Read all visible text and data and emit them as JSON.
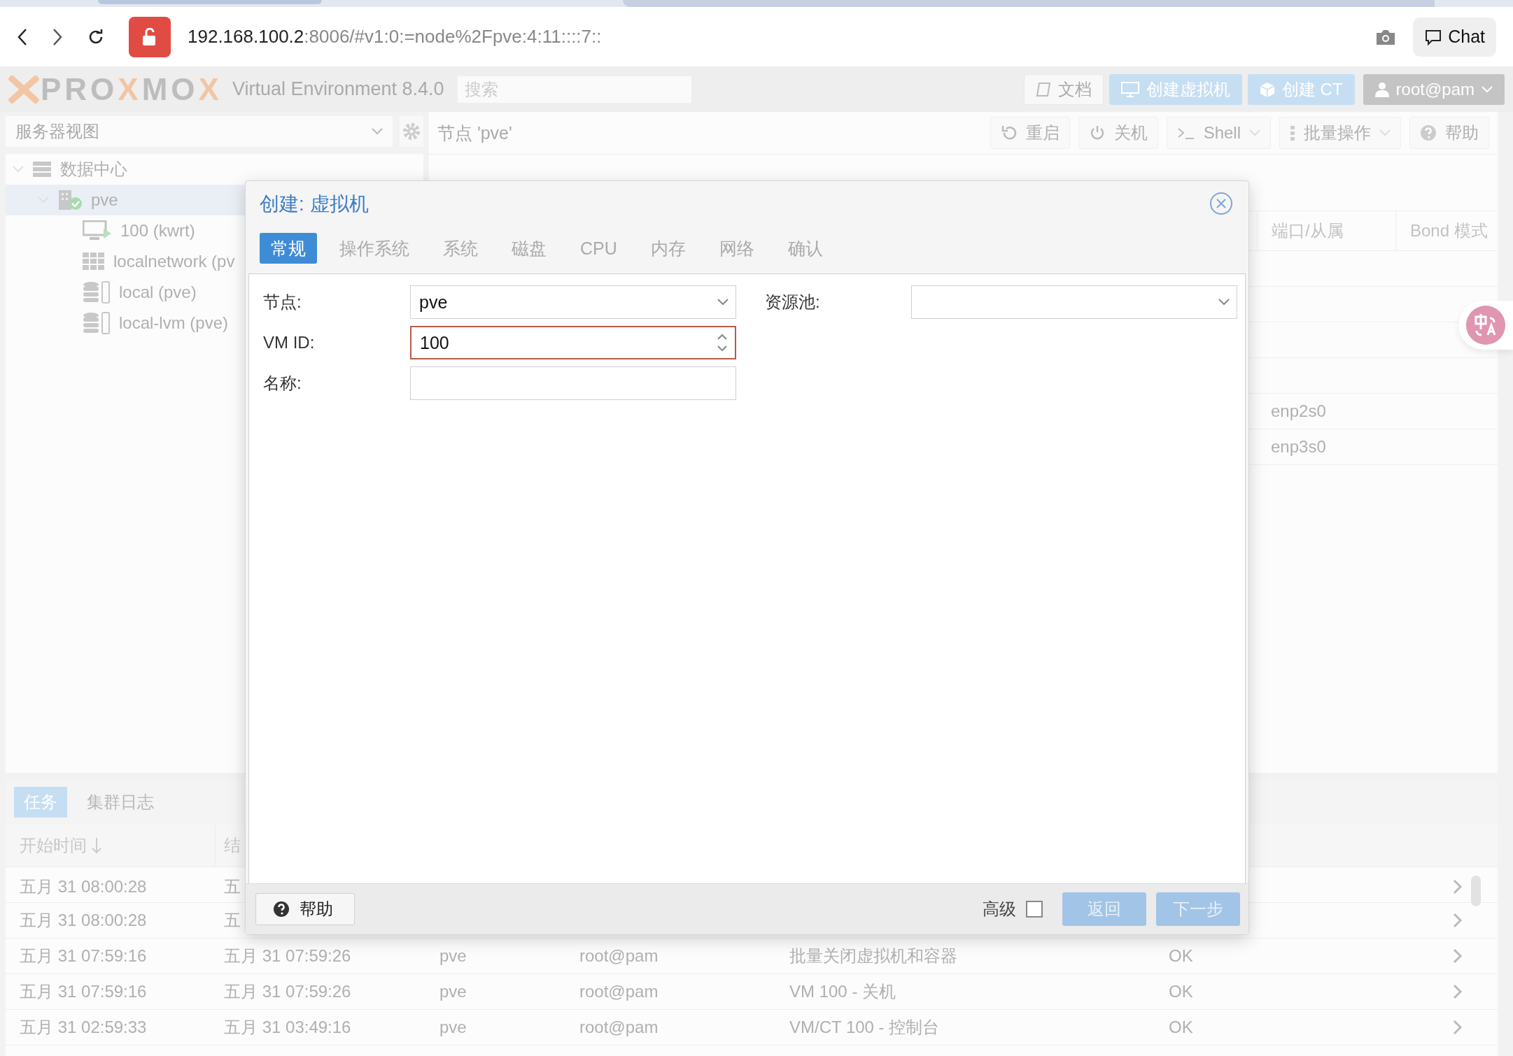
{
  "browser": {
    "url_host": "192.168.100.2",
    "url_rest": ":8006/#v1:0:=node%2Fpve:4:11::::7::",
    "chat_button": "Chat"
  },
  "header": {
    "logo": [
      "PRO",
      "X",
      "MO",
      "X"
    ],
    "product": "Virtual Environment 8.4.0",
    "search": {
      "placeholder": "搜索"
    },
    "buttons": [
      {
        "label": "文档",
        "kind": "docs"
      },
      {
        "label": "创建虚拟机",
        "kind": "vm"
      },
      {
        "label": "创建 CT",
        "kind": "ct"
      },
      {
        "label": "root@pam",
        "kind": "user"
      }
    ]
  },
  "sidebar": {
    "view_select": "服务器视图",
    "tree": [
      {
        "label": "数据中心",
        "kind": "datacenter",
        "selected": false,
        "expanded": true,
        "children": [
          {
            "label": "pve",
            "kind": "node",
            "selected": true,
            "expanded": true,
            "children": [
              {
                "label": "100 (kwrt)",
                "kind": "vm",
                "selected": false
              },
              {
                "label": "localnetwork (pv",
                "kind": "network",
                "selected": false
              },
              {
                "label": "local (pve)",
                "kind": "storage",
                "selected": false
              },
              {
                "label": "local-lvm (pve)",
                "kind": "storage",
                "selected": false
              }
            ]
          }
        ]
      }
    ]
  },
  "content": {
    "title": "节点 'pve'",
    "toolbar": [
      {
        "label": "重启",
        "kind": "reboot",
        "dropdown": false
      },
      {
        "label": "关机",
        "kind": "shutdown",
        "dropdown": false
      },
      {
        "label": "Shell",
        "kind": "shell",
        "dropdown": true
      },
      {
        "label": "批量操作",
        "kind": "bulk",
        "dropdown": true
      },
      {
        "label": "帮助",
        "kind": "help",
        "dropdown": false
      }
    ],
    "table": {
      "columns": [
        "端口/从属",
        "Bond 模式"
      ],
      "rows": [
        {
          "ports": "enp2s0"
        },
        {
          "ports": "enp3s0"
        }
      ]
    }
  },
  "tasks": {
    "tabs": [
      {
        "label": "任务",
        "selected": true
      },
      {
        "label": "集群日志",
        "selected": false
      }
    ],
    "columns": [
      {
        "label": "开始时间",
        "sort_descending": true
      },
      {
        "label": "结"
      }
    ],
    "rows": [
      {
        "start": "五月 31 08:00:28",
        "end": "五"
      },
      {
        "start": "五月 31 08:00:28",
        "end": "五"
      },
      {
        "start": "五月 31 07:59:16",
        "end": "五月 31 07:59:26",
        "node": "pve",
        "user": "root@pam",
        "description": "批量关闭虚拟机和容器",
        "status": "OK"
      },
      {
        "start": "五月 31 07:59:16",
        "end": "五月 31 07:59:26",
        "node": "pve",
        "user": "root@pam",
        "description": "VM 100 - 关机",
        "status": "OK"
      },
      {
        "start": "五月 31 02:59:33",
        "end": "五月 31 03:49:16",
        "node": "pve",
        "user": "root@pam",
        "description": "VM/CT 100 - 控制台",
        "status": "OK"
      }
    ]
  },
  "dialog": {
    "title": "创建: 虚拟机",
    "tabs": [
      {
        "label": "常规",
        "selected": true
      },
      {
        "label": "操作系统",
        "selected": false
      },
      {
        "label": "系统",
        "selected": false
      },
      {
        "label": "磁盘",
        "selected": false
      },
      {
        "label": "CPU",
        "selected": false
      },
      {
        "label": "内存",
        "selected": false
      },
      {
        "label": "网络",
        "selected": false
      },
      {
        "label": "确认",
        "selected": false
      }
    ],
    "fields": [
      {
        "label": "节点:",
        "value": "pve",
        "kind": "combo",
        "invalid": false
      },
      {
        "label": "VM ID:",
        "value": "100",
        "kind": "spinner",
        "invalid": true
      },
      {
        "label": "名称:",
        "kind": "text",
        "invalid": false
      }
    ],
    "side_fields": [
      {
        "label": "资源池:",
        "kind": "combo",
        "invalid": false
      }
    ],
    "help_button": "帮助",
    "advanced": {
      "label": "高级",
      "checked": false
    },
    "back_button": {
      "label": "返回",
      "disabled": true
    },
    "next_button": {
      "label": "下一步",
      "disabled": true
    }
  }
}
